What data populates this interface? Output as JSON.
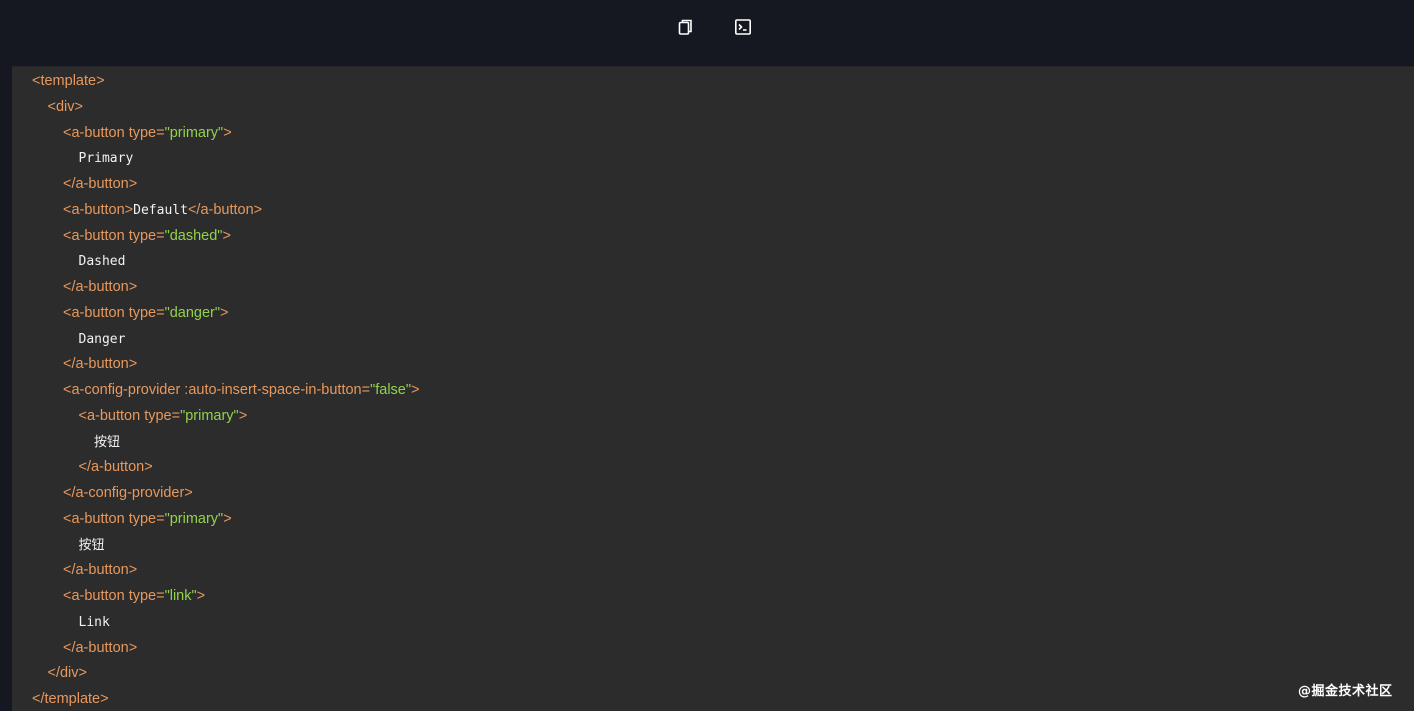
{
  "toolbar": {
    "icons": [
      "copy-icon",
      "terminal-icon"
    ]
  },
  "code": {
    "lines": [
      {
        "indent": 0,
        "parts": [
          {
            "k": "tag",
            "t": "<template>"
          }
        ]
      },
      {
        "indent": 1,
        "parts": [
          {
            "k": "tag",
            "t": "<div>"
          }
        ]
      },
      {
        "indent": 2,
        "parts": [
          {
            "k": "tag",
            "t": "<a-button type="
          },
          {
            "k": "str",
            "t": "\"primary\""
          },
          {
            "k": "tag",
            "t": ">"
          }
        ]
      },
      {
        "indent": 3,
        "parts": [
          {
            "k": "txt",
            "t": "Primary"
          }
        ]
      },
      {
        "indent": 2,
        "parts": [
          {
            "k": "tag",
            "t": "</a-button>"
          }
        ]
      },
      {
        "indent": 2,
        "parts": [
          {
            "k": "tag",
            "t": "<a-button>"
          },
          {
            "k": "txt",
            "t": "Default"
          },
          {
            "k": "tag",
            "t": "</a-button>"
          }
        ]
      },
      {
        "indent": 2,
        "parts": [
          {
            "k": "tag",
            "t": "<a-button type="
          },
          {
            "k": "str",
            "t": "\"dashed\""
          },
          {
            "k": "tag",
            "t": ">"
          }
        ]
      },
      {
        "indent": 3,
        "parts": [
          {
            "k": "txt",
            "t": "Dashed"
          }
        ]
      },
      {
        "indent": 2,
        "parts": [
          {
            "k": "tag",
            "t": "</a-button>"
          }
        ]
      },
      {
        "indent": 2,
        "parts": [
          {
            "k": "tag",
            "t": "<a-button type="
          },
          {
            "k": "str",
            "t": "\"danger\""
          },
          {
            "k": "tag",
            "t": ">"
          }
        ]
      },
      {
        "indent": 3,
        "parts": [
          {
            "k": "txt",
            "t": "Danger"
          }
        ]
      },
      {
        "indent": 2,
        "parts": [
          {
            "k": "tag",
            "t": "</a-button>"
          }
        ]
      },
      {
        "indent": 2,
        "parts": [
          {
            "k": "tag",
            "t": "<a-config-provider :auto-insert-space-in-button="
          },
          {
            "k": "str",
            "t": "\"false\""
          },
          {
            "k": "tag",
            "t": ">"
          }
        ]
      },
      {
        "indent": 3,
        "parts": [
          {
            "k": "tag",
            "t": "<a-button type="
          },
          {
            "k": "str",
            "t": "\"primary\""
          },
          {
            "k": "tag",
            "t": ">"
          }
        ]
      },
      {
        "indent": 4,
        "parts": [
          {
            "k": "txt",
            "t": "按钮"
          }
        ]
      },
      {
        "indent": 3,
        "parts": [
          {
            "k": "tag",
            "t": "</a-button>"
          }
        ]
      },
      {
        "indent": 2,
        "parts": [
          {
            "k": "tag",
            "t": "</a-config-provider>"
          }
        ]
      },
      {
        "indent": 2,
        "parts": [
          {
            "k": "tag",
            "t": "<a-button type="
          },
          {
            "k": "str",
            "t": "\"primary\""
          },
          {
            "k": "tag",
            "t": ">"
          }
        ]
      },
      {
        "indent": 3,
        "parts": [
          {
            "k": "txt",
            "t": "按钮"
          }
        ]
      },
      {
        "indent": 2,
        "parts": [
          {
            "k": "tag",
            "t": "</a-button>"
          }
        ]
      },
      {
        "indent": 2,
        "parts": [
          {
            "k": "tag",
            "t": "<a-button type="
          },
          {
            "k": "str",
            "t": "\"link\""
          },
          {
            "k": "tag",
            "t": ">"
          }
        ]
      },
      {
        "indent": 3,
        "parts": [
          {
            "k": "txt",
            "t": "Link"
          }
        ]
      },
      {
        "indent": 2,
        "parts": [
          {
            "k": "tag",
            "t": "</a-button>"
          }
        ]
      },
      {
        "indent": 1,
        "parts": [
          {
            "k": "tag",
            "t": "</div>"
          }
        ]
      },
      {
        "indent": 0,
        "parts": [
          {
            "k": "tag",
            "t": "</template>"
          }
        ]
      }
    ]
  },
  "watermark": "@掘金技术社区",
  "colors": {
    "tag": "#e8985c",
    "string": "#91d34a",
    "text": "#f2f2f2",
    "panel": "#2c2c2d",
    "toolbar": "#151821"
  }
}
